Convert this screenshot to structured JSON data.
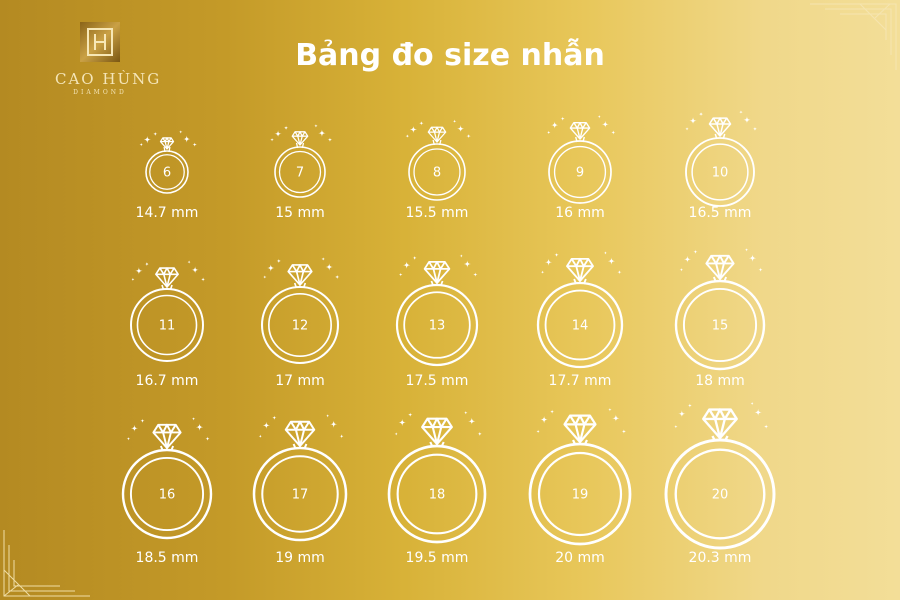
{
  "brand": {
    "name": "CAO HÙNG",
    "tagline": "DIAMOND",
    "logo_letter": "H"
  },
  "title": "Bảng đo size nhẫn",
  "colors": {
    "background_start": "#b48a22",
    "background_end": "#f3de98",
    "line": "#ffffff",
    "logo_gold": "#caa145"
  },
  "ring_icon": "diamond-ring-icon",
  "sizes": [
    {
      "size": "6",
      "mm": "14.7 mm"
    },
    {
      "size": "7",
      "mm": "15 mm"
    },
    {
      "size": "8",
      "mm": "15.5 mm"
    },
    {
      "size": "9",
      "mm": "16 mm"
    },
    {
      "size": "10",
      "mm": "16.5 mm"
    },
    {
      "size": "11",
      "mm": "16.7 mm"
    },
    {
      "size": "12",
      "mm": "17 mm"
    },
    {
      "size": "13",
      "mm": "17.5 mm"
    },
    {
      "size": "14",
      "mm": "17.7 mm"
    },
    {
      "size": "15",
      "mm": "18 mm"
    },
    {
      "size": "16",
      "mm": "18.5 mm"
    },
    {
      "size": "17",
      "mm": "19 mm"
    },
    {
      "size": "18",
      "mm": "19.5 mm"
    },
    {
      "size": "19",
      "mm": "20 mm"
    },
    {
      "size": "20",
      "mm": "20.3 mm"
    }
  ]
}
